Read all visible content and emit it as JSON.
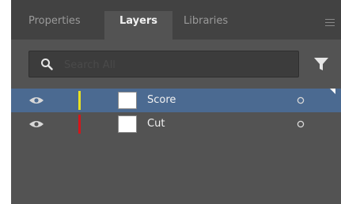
{
  "tabs": [
    {
      "label": "Properties",
      "active": false
    },
    {
      "label": "Layers",
      "active": true
    },
    {
      "label": "Libraries",
      "active": false
    }
  ],
  "search": {
    "placeholder": "Search All",
    "value": ""
  },
  "icons": {
    "menu": "menu-icon",
    "search": "search-icon",
    "filter": "filter-icon",
    "visibility": "eye-icon",
    "target": "target-icon"
  },
  "colors": {
    "panel_bg": "#535353",
    "tabbar_bg": "#424242",
    "selection": "#4b6a91",
    "score_layer_color": "#e8e021",
    "cut_layer_color": "#d4161b"
  },
  "layers": [
    {
      "name": "Score",
      "color": "#e8e021",
      "selected": true,
      "visible": true
    },
    {
      "name": "Cut",
      "color": "#d4161b",
      "selected": false,
      "visible": true
    }
  ]
}
